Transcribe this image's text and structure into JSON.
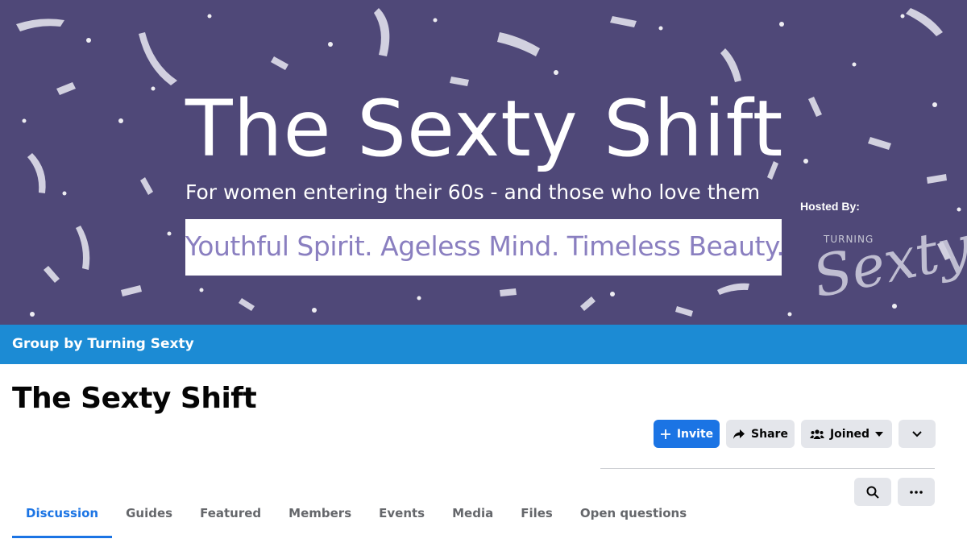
{
  "cover": {
    "title": "The Sexty Shift",
    "subtitle": "For women entering their 60s - and those who love them",
    "tagline": "Youthful Spirit. Ageless Mind. Timeless Beauty.",
    "hosted_by": "Hosted By:",
    "logo_small": "TURNING",
    "logo_big": "Sexty"
  },
  "group_bar": {
    "text": "Group by Turning Sexty"
  },
  "page_title": "The Sexty Shift",
  "actions": {
    "invite": "Invite",
    "share": "Share",
    "joined": "Joined"
  },
  "tabs": [
    {
      "label": "Discussion",
      "active": true
    },
    {
      "label": "Guides"
    },
    {
      "label": "Featured"
    },
    {
      "label": "Members"
    },
    {
      "label": "Events"
    },
    {
      "label": "Media"
    },
    {
      "label": "Files"
    },
    {
      "label": "Open questions"
    }
  ],
  "icons": {
    "invite": "plus-icon",
    "share": "share-arrow-icon",
    "joined": "group-people-icon",
    "joined_caret": "caret-down-icon",
    "more_dropdown": "chevron-down-icon",
    "search": "search-icon",
    "more": "ellipsis-icon"
  },
  "colors": {
    "cover_bg": "#4f4878",
    "group_bar": "#1c8bd4",
    "primary": "#1b74e4",
    "secondary_button": "#e4e6eb",
    "tagline_text": "#8a7fc0"
  }
}
